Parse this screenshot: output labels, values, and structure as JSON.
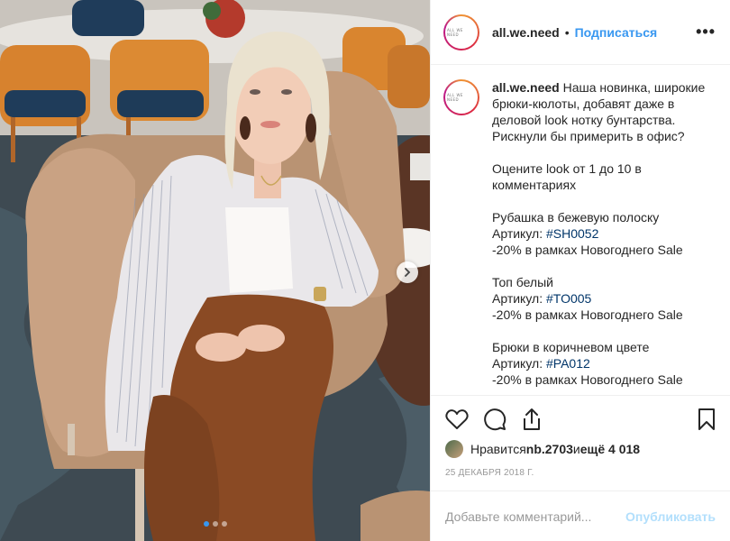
{
  "header": {
    "avatar_text": "ALL WE NEED",
    "username": "all.we.need",
    "separator": "•",
    "follow_label": "Подписаться",
    "more_label": "•••"
  },
  "caption": {
    "username": "all.we.need",
    "intro": " Наша новинка, широкие брюки-кюлоты, добавят даже в деловой look нотку бунтарства. Рискнули бы примерить в офис?\n\nОцените look от 1 до 10 в комментариях\n\nРубашка в бежевую полоску\nАртикул: ",
    "tag1": "#SH0052",
    "mid1": "\n-20% в рамках Новогоднего Sale\n\nТоп белый\nАртикул: ",
    "tag2": "#TO005",
    "mid2": "\n-20% в рамках Новогоднего Sale\n\nБрюки в коричневом цвете\nАртикул: ",
    "tag3": "#PA012",
    "tail": "\n-20% в рамках Новогоднего Sale"
  },
  "likes": {
    "prefix": "Нравится ",
    "user": "nb.2703",
    "and": " и ",
    "more": "ещё 4 018"
  },
  "date": "25 декабря 2018 г.",
  "comment_box": {
    "placeholder": "Добавьте комментарий...",
    "publish_label": "Опубликовать"
  },
  "carousel": {
    "slides": 3,
    "active": 0
  },
  "colors": {
    "accent": "#3897f0",
    "hashtag": "#003569",
    "publish_disabled": "#b2dffc",
    "meta": "#999999"
  },
  "icons": [
    "heart-icon",
    "comment-icon",
    "share-icon",
    "bookmark-icon",
    "chevron-right-icon",
    "more-icon"
  ]
}
